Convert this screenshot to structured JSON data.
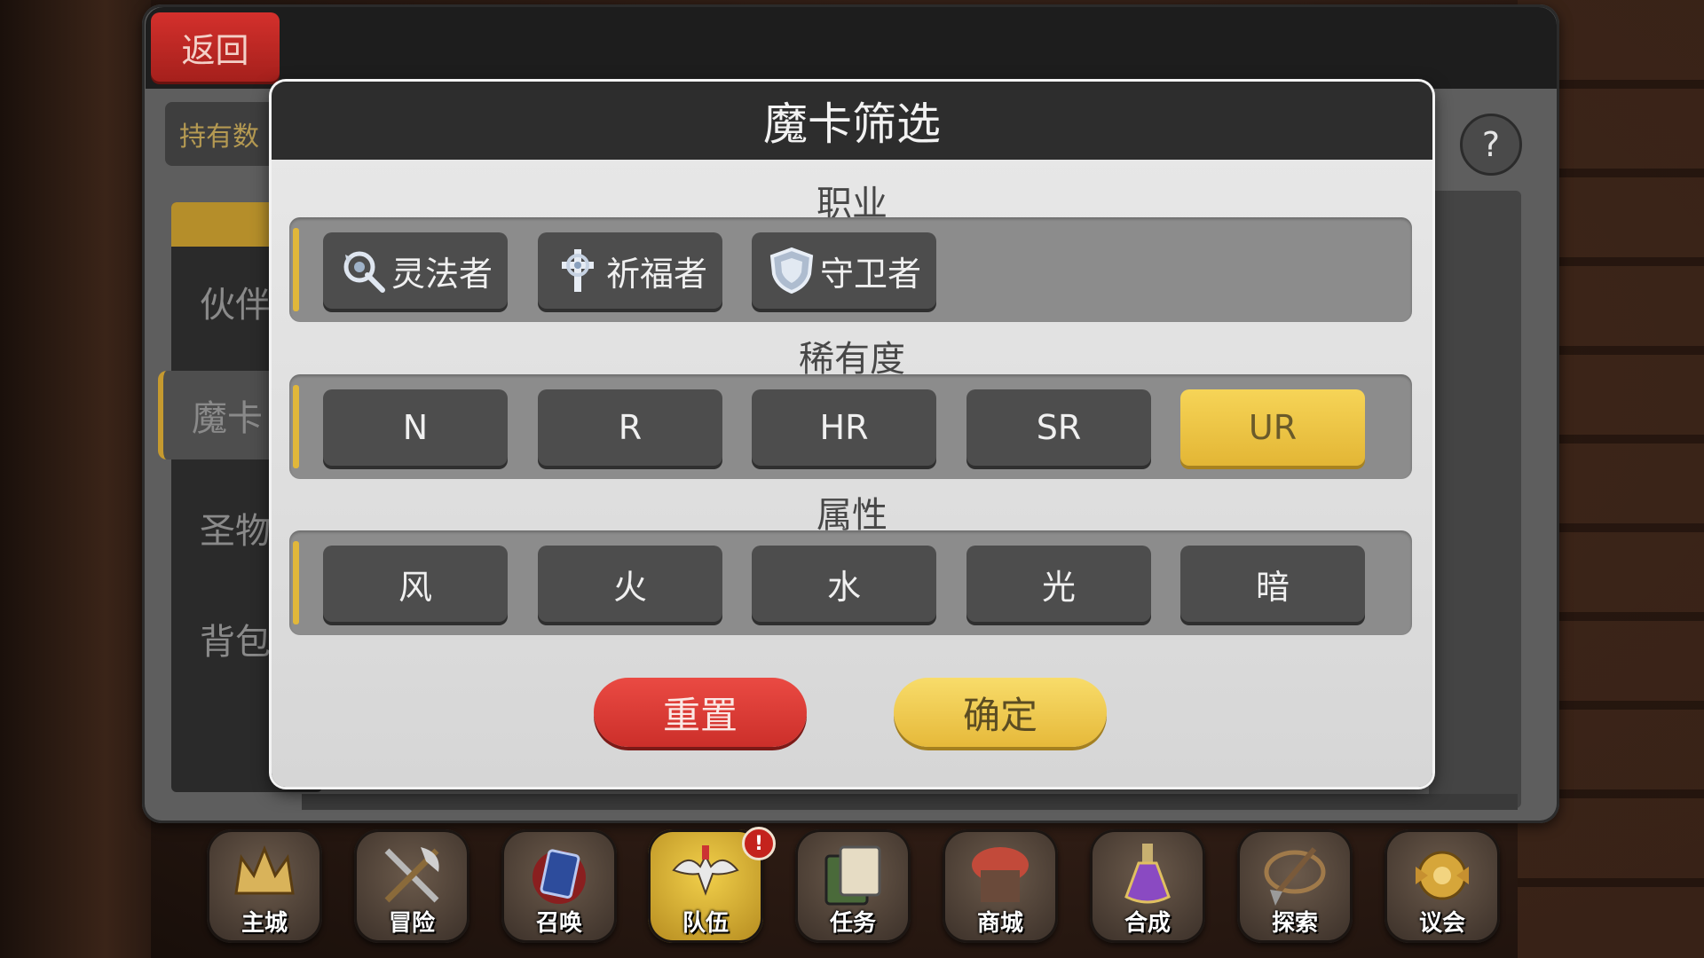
{
  "header": {
    "back_label": "返回",
    "owned_label": "持有数",
    "help_label": "?"
  },
  "sidebar": {
    "items": [
      {
        "label": "伙伴"
      },
      {
        "label": "魔卡"
      },
      {
        "label": "圣物"
      },
      {
        "label": "背包"
      }
    ]
  },
  "filter_dialog": {
    "title": "魔卡筛选",
    "class_section": {
      "label": "职业",
      "options": [
        {
          "label": "灵法者",
          "icon": "mage-staff-icon"
        },
        {
          "label": "祈福者",
          "icon": "holy-cross-icon"
        },
        {
          "label": "守卫者",
          "icon": "shield-icon"
        }
      ]
    },
    "rarity_section": {
      "label": "稀有度",
      "options": [
        {
          "label": "N",
          "selected": false
        },
        {
          "label": "R",
          "selected": false
        },
        {
          "label": "HR",
          "selected": false
        },
        {
          "label": "SR",
          "selected": false
        },
        {
          "label": "UR",
          "selected": true
        }
      ]
    },
    "attribute_section": {
      "label": "属性",
      "options": [
        {
          "label": "风"
        },
        {
          "label": "火"
        },
        {
          "label": "水"
        },
        {
          "label": "光"
        },
        {
          "label": "暗"
        }
      ]
    },
    "reset_label": "重置",
    "confirm_label": "确定"
  },
  "bottom_nav": {
    "items": [
      {
        "label": "主城",
        "icon": "crown-icon"
      },
      {
        "label": "冒险",
        "icon": "crossed-axes-icon"
      },
      {
        "label": "召唤",
        "icon": "summon-card-icon"
      },
      {
        "label": "队伍",
        "icon": "winged-helmet-icon",
        "active": true,
        "alert": "!"
      },
      {
        "label": "任务",
        "icon": "quest-book-icon"
      },
      {
        "label": "商城",
        "icon": "shop-icon"
      },
      {
        "label": "合成",
        "icon": "potion-icon"
      },
      {
        "label": "探索",
        "icon": "shovel-icon"
      },
      {
        "label": "议会",
        "icon": "council-emblem-icon"
      }
    ]
  },
  "colors": {
    "accent_gold": "#e3b635",
    "reset_red": "#cc2f2a",
    "panel_dark": "#2d2d2d"
  }
}
